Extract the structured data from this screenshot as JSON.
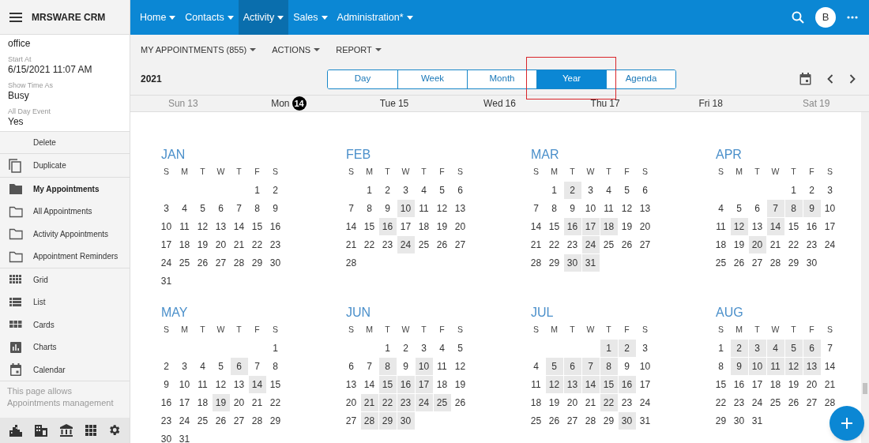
{
  "app": {
    "title": "MRSWARE CRM"
  },
  "details": [
    {
      "value": "office"
    },
    {
      "label": "Start At",
      "value": "6/15/2021 11:07 AM"
    },
    {
      "label": "Show Time As",
      "value": "Busy"
    },
    {
      "label": "All Day Event",
      "value": "Yes"
    }
  ],
  "actions": [
    {
      "label": "Delete",
      "kind": "plain"
    },
    {
      "label": "Duplicate",
      "kind": "copy"
    }
  ],
  "folders": [
    {
      "label": "My Appointments",
      "selected": true
    },
    {
      "label": "All Appointments",
      "selected": false
    },
    {
      "label": "Activity Appointments",
      "selected": false
    },
    {
      "label": "Appointment Reminders",
      "selected": false
    }
  ],
  "views": [
    {
      "label": "Grid",
      "kind": "grid"
    },
    {
      "label": "List",
      "kind": "list"
    },
    {
      "label": "Cards",
      "kind": "cards"
    },
    {
      "label": "Charts",
      "kind": "charts"
    },
    {
      "label": "Calendar",
      "kind": "calendar"
    }
  ],
  "sidebar_note": "This page allows Appointments management",
  "nav": [
    {
      "label": "Home",
      "selected": false
    },
    {
      "label": "Contacts",
      "selected": false
    },
    {
      "label": "Activity",
      "selected": true
    },
    {
      "label": "Sales",
      "selected": false
    },
    {
      "label": "Administration*",
      "selected": false
    }
  ],
  "avatar": "B",
  "toolbar_menus": [
    "MY APPOINTMENTS (855)",
    "ACTIONS",
    "REPORT"
  ],
  "year_label": "2021",
  "view_tabs": [
    {
      "label": "Day",
      "selected": false
    },
    {
      "label": "Week",
      "selected": false
    },
    {
      "label": "Month",
      "selected": false
    },
    {
      "label": "Year",
      "selected": true
    },
    {
      "label": "Agenda",
      "selected": false
    }
  ],
  "week_days": [
    {
      "label": "Sun",
      "date": "13",
      "today": false
    },
    {
      "label": "Mon",
      "date": "14",
      "today": true
    },
    {
      "label": "Tue",
      "date": "15",
      "today": false
    },
    {
      "label": "Wed",
      "date": "16",
      "today": false
    },
    {
      "label": "Thu",
      "date": "17",
      "today": false
    },
    {
      "label": "Fri",
      "date": "18",
      "today": false
    },
    {
      "label": "Sat",
      "date": "19",
      "today": false
    }
  ],
  "months": [
    {
      "name": "JAN",
      "weekdays": [
        "S",
        "M",
        "T",
        "W",
        "T",
        "F",
        "S"
      ],
      "weeks": [
        [
          {
            "day": "1",
            "busy": false
          },
          {
            "day": "2",
            "busy": false
          }
        ],
        [
          {
            "day": "3",
            "busy": false
          },
          {
            "day": "4",
            "busy": false
          },
          {
            "day": "5",
            "busy": false
          },
          {
            "day": "6",
            "busy": false
          },
          {
            "day": "7",
            "busy": false
          },
          {
            "day": "8",
            "busy": false
          },
          {
            "day": "9",
            "busy": false
          }
        ],
        [
          {
            "day": "10",
            "busy": false
          },
          {
            "day": "11",
            "busy": false
          },
          {
            "day": "12",
            "busy": false
          },
          {
            "day": "13",
            "busy": false
          },
          {
            "day": "14",
            "busy": false
          },
          {
            "day": "15",
            "busy": false
          },
          {
            "day": "16",
            "busy": false
          }
        ],
        [
          {
            "day": "17",
            "busy": false
          },
          {
            "day": "18",
            "busy": false
          },
          {
            "day": "19",
            "busy": false
          },
          {
            "day": "20",
            "busy": false
          },
          {
            "day": "21",
            "busy": false
          },
          {
            "day": "22",
            "busy": false
          },
          {
            "day": "23",
            "busy": false
          }
        ],
        [
          {
            "day": "24",
            "busy": false
          },
          {
            "day": "25",
            "busy": false
          },
          {
            "day": "26",
            "busy": false
          },
          {
            "day": "27",
            "busy": false
          },
          {
            "day": "28",
            "busy": false
          },
          {
            "day": "29",
            "busy": false
          },
          {
            "day": "30",
            "busy": false
          }
        ],
        [
          {
            "day": "31",
            "busy": false
          }
        ]
      ]
    },
    {
      "name": "FEB",
      "weekdays": [
        "S",
        "M",
        "T",
        "W",
        "T",
        "F",
        "S"
      ],
      "weeks": [
        [
          {
            "day": "1",
            "busy": false
          },
          {
            "day": "2",
            "busy": false
          },
          {
            "day": "3",
            "busy": false
          },
          {
            "day": "4",
            "busy": false
          },
          {
            "day": "5",
            "busy": false
          },
          {
            "day": "6",
            "busy": false
          }
        ],
        [
          {
            "day": "7",
            "busy": false
          },
          {
            "day": "8",
            "busy": false
          },
          {
            "day": "9",
            "busy": false
          },
          {
            "day": "10",
            "busy": true
          },
          {
            "day": "11",
            "busy": false
          },
          {
            "day": "12",
            "busy": false
          },
          {
            "day": "13",
            "busy": false
          }
        ],
        [
          {
            "day": "14",
            "busy": false
          },
          {
            "day": "15",
            "busy": false
          },
          {
            "day": "16",
            "busy": true
          },
          {
            "day": "17",
            "busy": false
          },
          {
            "day": "18",
            "busy": false
          },
          {
            "day": "19",
            "busy": false
          },
          {
            "day": "20",
            "busy": false
          }
        ],
        [
          {
            "day": "21",
            "busy": false
          },
          {
            "day": "22",
            "busy": false
          },
          {
            "day": "23",
            "busy": false
          },
          {
            "day": "24",
            "busy": true
          },
          {
            "day": "25",
            "busy": false
          },
          {
            "day": "26",
            "busy": false
          },
          {
            "day": "27",
            "busy": false
          }
        ],
        [
          {
            "day": "28",
            "busy": false
          }
        ]
      ]
    },
    {
      "name": "MAR",
      "weekdays": [
        "S",
        "M",
        "T",
        "W",
        "T",
        "F",
        "S"
      ],
      "weeks": [
        [
          {
            "day": "1",
            "busy": false
          },
          {
            "day": "2",
            "busy": true
          },
          {
            "day": "3",
            "busy": false
          },
          {
            "day": "4",
            "busy": false
          },
          {
            "day": "5",
            "busy": false
          },
          {
            "day": "6",
            "busy": false
          }
        ],
        [
          {
            "day": "7",
            "busy": false
          },
          {
            "day": "8",
            "busy": false
          },
          {
            "day": "9",
            "busy": false
          },
          {
            "day": "10",
            "busy": false
          },
          {
            "day": "11",
            "busy": false
          },
          {
            "day": "12",
            "busy": false
          },
          {
            "day": "13",
            "busy": false
          }
        ],
        [
          {
            "day": "14",
            "busy": false
          },
          {
            "day": "15",
            "busy": false
          },
          {
            "day": "16",
            "busy": true
          },
          {
            "day": "17",
            "busy": true
          },
          {
            "day": "18",
            "busy": true
          },
          {
            "day": "19",
            "busy": false
          },
          {
            "day": "20",
            "busy": false
          }
        ],
        [
          {
            "day": "21",
            "busy": false
          },
          {
            "day": "22",
            "busy": false
          },
          {
            "day": "23",
            "busy": false
          },
          {
            "day": "24",
            "busy": true
          },
          {
            "day": "25",
            "busy": false
          },
          {
            "day": "26",
            "busy": false
          },
          {
            "day": "27",
            "busy": false
          }
        ],
        [
          {
            "day": "28",
            "busy": false
          },
          {
            "day": "29",
            "busy": false
          },
          {
            "day": "30",
            "busy": true
          },
          {
            "day": "31",
            "busy": true
          }
        ]
      ]
    },
    {
      "name": "APR",
      "weekdays": [
        "S",
        "M",
        "T",
        "W",
        "T",
        "F",
        "S"
      ],
      "weeks": [
        [
          {
            "day": "1",
            "busy": false
          },
          {
            "day": "2",
            "busy": false
          },
          {
            "day": "3",
            "busy": false
          }
        ],
        [
          {
            "day": "4",
            "busy": false
          },
          {
            "day": "5",
            "busy": false
          },
          {
            "day": "6",
            "busy": false
          },
          {
            "day": "7",
            "busy": true
          },
          {
            "day": "8",
            "busy": true
          },
          {
            "day": "9",
            "busy": true
          },
          {
            "day": "10",
            "busy": false
          }
        ],
        [
          {
            "day": "11",
            "busy": false
          },
          {
            "day": "12",
            "busy": true
          },
          {
            "day": "13",
            "busy": false
          },
          {
            "day": "14",
            "busy": true
          },
          {
            "day": "15",
            "busy": false
          },
          {
            "day": "16",
            "busy": false
          },
          {
            "day": "17",
            "busy": false
          }
        ],
        [
          {
            "day": "18",
            "busy": false
          },
          {
            "day": "19",
            "busy": false
          },
          {
            "day": "20",
            "busy": true
          },
          {
            "day": "21",
            "busy": false
          },
          {
            "day": "22",
            "busy": false
          },
          {
            "day": "23",
            "busy": false
          },
          {
            "day": "24",
            "busy": false
          }
        ],
        [
          {
            "day": "25",
            "busy": false
          },
          {
            "day": "26",
            "busy": false
          },
          {
            "day": "27",
            "busy": false
          },
          {
            "day": "28",
            "busy": false
          },
          {
            "day": "29",
            "busy": false
          },
          {
            "day": "30",
            "busy": false
          }
        ]
      ]
    },
    {
      "name": "MAY",
      "weekdays": [
        "S",
        "M",
        "T",
        "W",
        "T",
        "F",
        "S"
      ],
      "weeks": [
        [
          {
            "day": "1",
            "busy": false
          }
        ],
        [
          {
            "day": "2",
            "busy": false
          },
          {
            "day": "3",
            "busy": false
          },
          {
            "day": "4",
            "busy": false
          },
          {
            "day": "5",
            "busy": false
          },
          {
            "day": "6",
            "busy": true
          },
          {
            "day": "7",
            "busy": false
          },
          {
            "day": "8",
            "busy": false
          }
        ],
        [
          {
            "day": "9",
            "busy": false
          },
          {
            "day": "10",
            "busy": false
          },
          {
            "day": "11",
            "busy": false
          },
          {
            "day": "12",
            "busy": false
          },
          {
            "day": "13",
            "busy": false
          },
          {
            "day": "14",
            "busy": true
          },
          {
            "day": "15",
            "busy": false
          }
        ],
        [
          {
            "day": "16",
            "busy": false
          },
          {
            "day": "17",
            "busy": false
          },
          {
            "day": "18",
            "busy": false
          },
          {
            "day": "19",
            "busy": true
          },
          {
            "day": "20",
            "busy": false
          },
          {
            "day": "21",
            "busy": false
          },
          {
            "day": "22",
            "busy": false
          }
        ],
        [
          {
            "day": "23",
            "busy": false
          },
          {
            "day": "24",
            "busy": false
          },
          {
            "day": "25",
            "busy": false
          },
          {
            "day": "26",
            "busy": false
          },
          {
            "day": "27",
            "busy": false
          },
          {
            "day": "28",
            "busy": false
          },
          {
            "day": "29",
            "busy": false
          }
        ],
        [
          {
            "day": "30",
            "busy": false
          },
          {
            "day": "31",
            "busy": false
          }
        ]
      ]
    },
    {
      "name": "JUN",
      "weekdays": [
        "S",
        "M",
        "T",
        "W",
        "T",
        "F",
        "S"
      ],
      "weeks": [
        [
          {
            "day": "1",
            "busy": false
          },
          {
            "day": "2",
            "busy": false
          },
          {
            "day": "3",
            "busy": false
          },
          {
            "day": "4",
            "busy": false
          },
          {
            "day": "5",
            "busy": false
          }
        ],
        [
          {
            "day": "6",
            "busy": false
          },
          {
            "day": "7",
            "busy": false
          },
          {
            "day": "8",
            "busy": true
          },
          {
            "day": "9",
            "busy": false
          },
          {
            "day": "10",
            "busy": true
          },
          {
            "day": "11",
            "busy": false
          },
          {
            "day": "12",
            "busy": false
          }
        ],
        [
          {
            "day": "13",
            "busy": false
          },
          {
            "day": "14",
            "busy": false
          },
          {
            "day": "15",
            "busy": true
          },
          {
            "day": "16",
            "busy": true
          },
          {
            "day": "17",
            "busy": true
          },
          {
            "day": "18",
            "busy": false
          },
          {
            "day": "19",
            "busy": false
          }
        ],
        [
          {
            "day": "20",
            "busy": false
          },
          {
            "day": "21",
            "busy": true
          },
          {
            "day": "22",
            "busy": true
          },
          {
            "day": "23",
            "busy": true
          },
          {
            "day": "24",
            "busy": true
          },
          {
            "day": "25",
            "busy": true
          },
          {
            "day": "26",
            "busy": false
          }
        ],
        [
          {
            "day": "27",
            "busy": false
          },
          {
            "day": "28",
            "busy": true
          },
          {
            "day": "29",
            "busy": true
          },
          {
            "day": "30",
            "busy": true
          }
        ]
      ]
    },
    {
      "name": "JUL",
      "weekdays": [
        "S",
        "M",
        "T",
        "W",
        "T",
        "F",
        "S"
      ],
      "weeks": [
        [
          {
            "day": "1",
            "busy": true
          },
          {
            "day": "2",
            "busy": true
          },
          {
            "day": "3",
            "busy": false
          }
        ],
        [
          {
            "day": "4",
            "busy": false
          },
          {
            "day": "5",
            "busy": true
          },
          {
            "day": "6",
            "busy": true
          },
          {
            "day": "7",
            "busy": true
          },
          {
            "day": "8",
            "busy": true
          },
          {
            "day": "9",
            "busy": false
          },
          {
            "day": "10",
            "busy": false
          }
        ],
        [
          {
            "day": "11",
            "busy": false
          },
          {
            "day": "12",
            "busy": true
          },
          {
            "day": "13",
            "busy": true
          },
          {
            "day": "14",
            "busy": true
          },
          {
            "day": "15",
            "busy": true
          },
          {
            "day": "16",
            "busy": true
          },
          {
            "day": "17",
            "busy": false
          }
        ],
        [
          {
            "day": "18",
            "busy": false
          },
          {
            "day": "19",
            "busy": false
          },
          {
            "day": "20",
            "busy": false
          },
          {
            "day": "21",
            "busy": false
          },
          {
            "day": "22",
            "busy": true
          },
          {
            "day": "23",
            "busy": false
          },
          {
            "day": "24",
            "busy": false
          }
        ],
        [
          {
            "day": "25",
            "busy": false
          },
          {
            "day": "26",
            "busy": false
          },
          {
            "day": "27",
            "busy": false
          },
          {
            "day": "28",
            "busy": false
          },
          {
            "day": "29",
            "busy": false
          },
          {
            "day": "30",
            "busy": true
          },
          {
            "day": "31",
            "busy": false
          }
        ]
      ]
    },
    {
      "name": "AUG",
      "weekdays": [
        "S",
        "M",
        "T",
        "W",
        "T",
        "F",
        "S"
      ],
      "weeks": [
        [
          {
            "day": "1",
            "busy": false
          },
          {
            "day": "2",
            "busy": true
          },
          {
            "day": "3",
            "busy": true
          },
          {
            "day": "4",
            "busy": true
          },
          {
            "day": "5",
            "busy": true
          },
          {
            "day": "6",
            "busy": true
          },
          {
            "day": "7",
            "busy": false
          }
        ],
        [
          {
            "day": "8",
            "busy": false
          },
          {
            "day": "9",
            "busy": true
          },
          {
            "day": "10",
            "busy": true
          },
          {
            "day": "11",
            "busy": true
          },
          {
            "day": "12",
            "busy": true
          },
          {
            "day": "13",
            "busy": true
          },
          {
            "day": "14",
            "busy": false
          }
        ],
        [
          {
            "day": "15",
            "busy": false
          },
          {
            "day": "16",
            "busy": false
          },
          {
            "day": "17",
            "busy": false
          },
          {
            "day": "18",
            "busy": false
          },
          {
            "day": "19",
            "busy": false
          },
          {
            "day": "20",
            "busy": false
          },
          {
            "day": "21",
            "busy": false
          }
        ],
        [
          {
            "day": "22",
            "busy": false
          },
          {
            "day": "23",
            "busy": false
          },
          {
            "day": "24",
            "busy": false
          },
          {
            "day": "25",
            "busy": false
          },
          {
            "day": "26",
            "busy": false
          },
          {
            "day": "27",
            "busy": false
          },
          {
            "day": "28",
            "busy": false
          }
        ],
        [
          {
            "day": "29",
            "busy": false
          },
          {
            "day": "30",
            "busy": false
          },
          {
            "day": "31",
            "busy": false
          }
        ]
      ]
    }
  ]
}
